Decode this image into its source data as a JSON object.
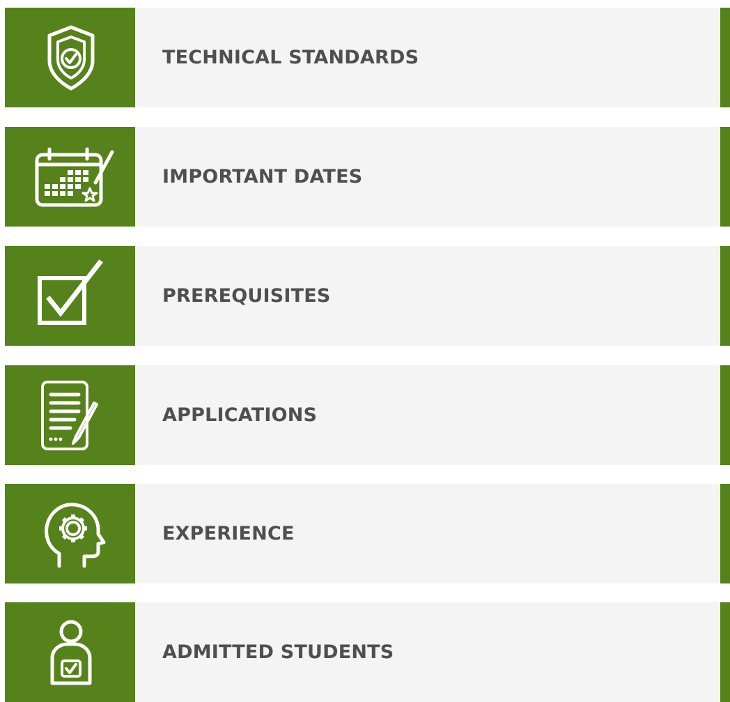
{
  "theme": {
    "accent": "#55821a",
    "panel": "#f4f4f4",
    "text": "#4f4f4f"
  },
  "nav": {
    "items": [
      {
        "label": "TECHNICAL STANDARDS",
        "icon": "shield-check-icon"
      },
      {
        "label": "IMPORTANT DATES",
        "icon": "calendar-icon"
      },
      {
        "label": "PREREQUISITES",
        "icon": "checkbox-icon"
      },
      {
        "label": "APPLICATIONS",
        "icon": "document-pen-icon"
      },
      {
        "label": "EXPERIENCE",
        "icon": "head-gear-icon"
      },
      {
        "label": "ADMITTED STUDENTS",
        "icon": "student-check-icon"
      }
    ]
  }
}
